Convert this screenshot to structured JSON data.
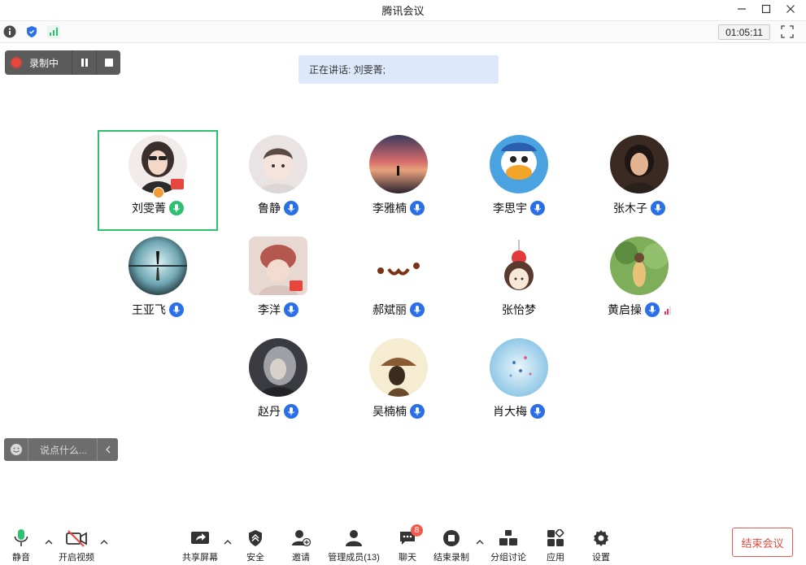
{
  "window": {
    "title": "腾讯会议"
  },
  "info_bar": {
    "timer": "01:05:11"
  },
  "recording": {
    "label": "录制中"
  },
  "speaking": {
    "text": "正在讲话: 刘雯菁;"
  },
  "participants": [
    {
      "name": "刘雯菁"
    },
    {
      "name": "鲁静"
    },
    {
      "name": "李雅楠"
    },
    {
      "name": "李思宇"
    },
    {
      "name": "张木子"
    },
    {
      "name": "王亚飞"
    },
    {
      "name": "李洋"
    },
    {
      "name": "郝斌丽"
    },
    {
      "name": "张怡梦"
    },
    {
      "name": "黄启操"
    },
    {
      "name": "赵丹"
    },
    {
      "name": "吴楠楠"
    },
    {
      "name": "肖大梅"
    }
  ],
  "chat_input": {
    "placeholder": "说点什么..."
  },
  "toolbar": {
    "mute": "静音",
    "video": "开启视频",
    "share": "共享屏幕",
    "security": "安全",
    "invite": "邀请",
    "members": "管理成员(13)",
    "chat": "聊天",
    "chat_badge": "8",
    "end_record": "结束录制",
    "breakout": "分组讨论",
    "apps": "应用",
    "settings": "设置",
    "end_meeting": "结束会议"
  },
  "colors": {
    "accent_blue": "#2a6fe8",
    "active_green": "#2fbf71",
    "recording_red": "#e8453c",
    "end_red": "#e34b3f",
    "speaking_bg": "#dde9fb"
  }
}
